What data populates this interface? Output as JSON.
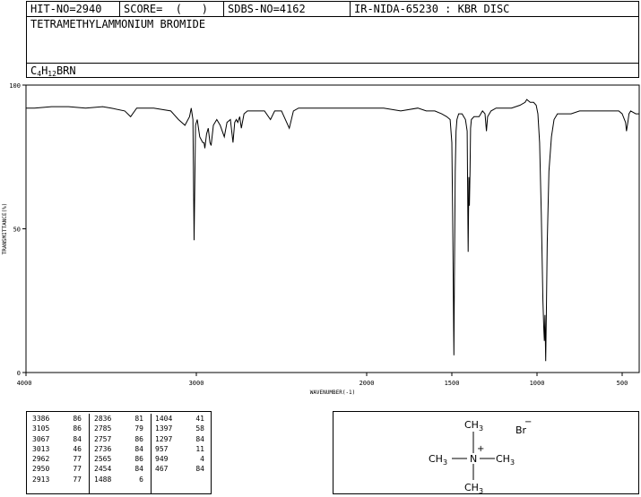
{
  "header": {
    "hit_no": "HIT-NO=2940",
    "score": "SCORE=  (   )",
    "sdbs_no": "SDBS-NO=4162",
    "ir_id": "IR-NIDA-65230 : KBR DISC",
    "compound_name": "TETRAMETHYLAMMONIUM BROMIDE",
    "formula": {
      "c": "C",
      "c_sub": "4",
      "h": "H",
      "h_sub": "12",
      "rest": "BRN"
    }
  },
  "chart_data": {
    "type": "line",
    "title": "",
    "xlabel": "WAVENUMBER(-1)",
    "ylabel": "TRANSMITTANCE(%)",
    "xlim": [
      4000,
      400
    ],
    "ylim": [
      0,
      100
    ],
    "x_ticks": [
      4000,
      3000,
      2000,
      1500,
      1000,
      500
    ],
    "y_ticks": [
      0,
      50,
      100
    ],
    "series": [
      {
        "x": [
          4000,
          3950,
          3850,
          3750,
          3650,
          3550,
          3500,
          3420,
          3386,
          3350,
          3250,
          3150,
          3105,
          3067,
          3040,
          3030,
          3020,
          3013,
          3005,
          2995,
          2980,
          2962,
          2955,
          2950,
          2940,
          2930,
          2920,
          2913,
          2900,
          2880,
          2860,
          2836,
          2820,
          2800,
          2785,
          2775,
          2765,
          2757,
          2745,
          2736,
          2720,
          2700,
          2650,
          2600,
          2565,
          2540,
          2500,
          2454,
          2430,
          2400,
          2300,
          2200,
          2100,
          2000,
          1900,
          1800,
          1700,
          1650,
          1600,
          1560,
          1530,
          1510,
          1500,
          1495,
          1490,
          1488,
          1485,
          1480,
          1475,
          1470,
          1460,
          1440,
          1420,
          1410,
          1404,
          1400,
          1397,
          1393,
          1390,
          1385,
          1370,
          1340,
          1320,
          1305,
          1297,
          1290,
          1270,
          1240,
          1200,
          1150,
          1100,
          1070,
          1060,
          1040,
          1020,
          1005,
          995,
          985,
          975,
          965,
          960,
          957,
          953,
          949,
          945,
          940,
          930,
          915,
          900,
          880,
          860,
          840,
          800,
          750,
          700,
          650,
          600,
          560,
          520,
          500,
          480,
          475,
          467,
          460,
          450,
          420,
          400
        ],
        "y": [
          92,
          92,
          92.5,
          92.5,
          92,
          92.5,
          92,
          91,
          89,
          92,
          92,
          91,
          88,
          86,
          89,
          92,
          88,
          46,
          86,
          88,
          82,
          80,
          80,
          78,
          83,
          85,
          80,
          79,
          86,
          88,
          86,
          82,
          87,
          88,
          80,
          87,
          88,
          87,
          89,
          85,
          90,
          91,
          91,
          91,
          88,
          91,
          91,
          85,
          91,
          92,
          92,
          92,
          92,
          92,
          92,
          91,
          92,
          91,
          91,
          90,
          89,
          88,
          80,
          55,
          20,
          6,
          30,
          70,
          84,
          88,
          90,
          90,
          88,
          84,
          42,
          68,
          58,
          70,
          85,
          88,
          89,
          89,
          91,
          90,
          84,
          89,
          91,
          92,
          92,
          92,
          93,
          94,
          95,
          94,
          94,
          93,
          90,
          80,
          55,
          25,
          15,
          11,
          20,
          4,
          20,
          45,
          70,
          82,
          88,
          90,
          90,
          90,
          90,
          91,
          91,
          91,
          91,
          91,
          91,
          90,
          87,
          84,
          87,
          90,
          91,
          90,
          90
        ]
      }
    ],
    "peak_table": [
      [
        [
          3386,
          86
        ],
        [
          3105,
          86
        ],
        [
          3067,
          84
        ],
        [
          3013,
          46
        ],
        [
          2962,
          77
        ],
        [
          2950,
          77
        ],
        [
          2913,
          77
        ]
      ],
      [
        [
          2836,
          81
        ],
        [
          2785,
          79
        ],
        [
          2757,
          86
        ],
        [
          2736,
          84
        ],
        [
          2565,
          86
        ],
        [
          2454,
          84
        ],
        [
          1488,
          6
        ]
      ],
      [
        [
          1404,
          41
        ],
        [
          1397,
          58
        ],
        [
          1297,
          84
        ],
        [
          957,
          11
        ],
        [
          949,
          4
        ],
        [
          467,
          84
        ]
      ]
    ]
  },
  "structure": {
    "ch3_top": "CH3",
    "ch3_left": "CH3",
    "ch3_right": "CH3",
    "ch3_bottom": "CH3",
    "n": "N",
    "plus": "+",
    "br": "Br",
    "minus": "−"
  }
}
